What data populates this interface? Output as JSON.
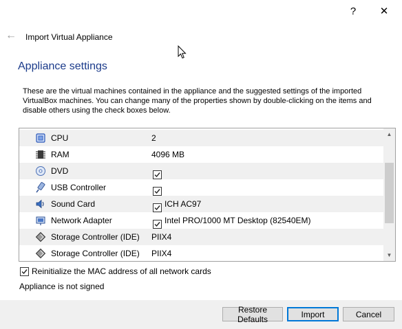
{
  "titlebar": {
    "help_glyph": "?",
    "close_glyph": "✕"
  },
  "header": {
    "back_glyph": "←",
    "title": "Import Virtual Appliance"
  },
  "page": {
    "heading": "Appliance settings",
    "description": "These are the virtual machines contained in the appliance and the suggested settings of the imported VirtualBox machines. You can change many of the properties shown by double-clicking on the items and disable others using the check boxes below."
  },
  "settings": {
    "rows": [
      {
        "icon": "cpu-icon",
        "name": "CPU",
        "value": "2"
      },
      {
        "icon": "ram-icon",
        "name": "RAM",
        "value": "4096 MB"
      },
      {
        "icon": "dvd-icon",
        "name": "DVD",
        "checked": true,
        "value": ""
      },
      {
        "icon": "usb-icon",
        "name": "USB Controller",
        "checked": true,
        "value": ""
      },
      {
        "icon": "sound-card-icon",
        "name": "Sound Card",
        "checked": true,
        "value": "ICH AC97"
      },
      {
        "icon": "network-adapter-icon",
        "name": "Network Adapter",
        "checked": true,
        "value": "Intel PRO/1000 MT Desktop (82540EM)"
      },
      {
        "icon": "storage-controller-icon",
        "name": "Storage Controller (IDE)",
        "value": "PIIX4"
      },
      {
        "icon": "storage-controller-icon",
        "name": "Storage Controller (IDE)",
        "value": "PIIX4"
      }
    ]
  },
  "options": {
    "reinit_mac_label": "Reinitialize the MAC address of all network cards",
    "reinit_mac_checked": true,
    "signature_status": "Appliance is not signed"
  },
  "buttons": {
    "restore_defaults": "Restore Defaults",
    "import": "Import",
    "cancel": "Cancel"
  },
  "colors": {
    "heading": "#1a3a8a",
    "accent": "#0078d7"
  }
}
